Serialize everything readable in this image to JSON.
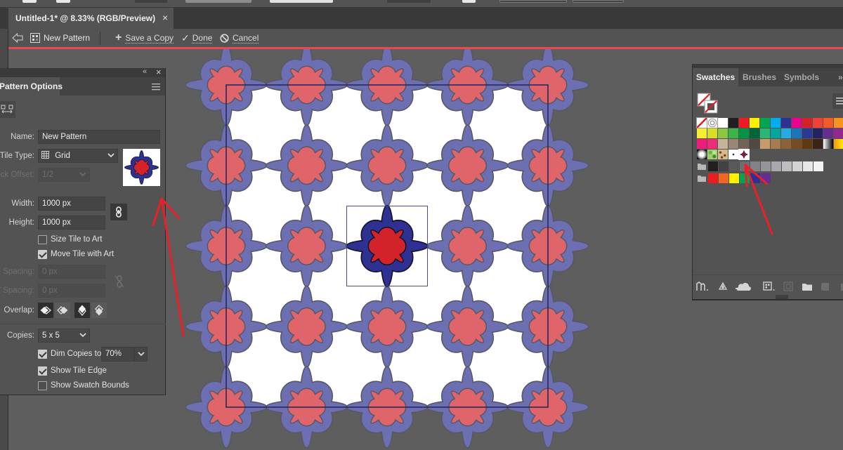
{
  "document_tab": {
    "title": "Untitled-1* @ 8.33% (RGB/Preview)",
    "close_label": "×"
  },
  "pattern_bar": {
    "pattern_name": "New Pattern",
    "save_copy_label": "Save a Copy",
    "done_label": "Done",
    "cancel_label": "Cancel",
    "accent_color": "#e8484f",
    "icons": [
      "exit-isolation-arrow-icon",
      "pattern-icon",
      "plus-icon",
      "checkmark-icon",
      "cancel-circle-icon"
    ]
  },
  "pattern_options": {
    "title": "Pattern Options",
    "collapse_label": "«",
    "close_label": "×",
    "name": {
      "label": "Name:",
      "value": "New Pattern"
    },
    "tile_type": {
      "label": "Tile Type:",
      "value": "Grid"
    },
    "brick_offset": {
      "label": "Brick Offset:",
      "value": "1/2",
      "disabled": true
    },
    "width": {
      "label": "Width:",
      "value": "1000 px"
    },
    "height": {
      "label": "Height:",
      "value": "1000 px"
    },
    "size_tile_to_art": {
      "label": "Size Tile to Art",
      "checked": false
    },
    "move_tile_with_art": {
      "label": "Move Tile with Art",
      "checked": true
    },
    "h_spacing": {
      "label": "H Spacing:",
      "value": "0 px",
      "disabled": true
    },
    "v_spacing": {
      "label": "V Spacing:",
      "value": "0 px",
      "disabled": true
    },
    "overlap": {
      "label": "Overlap:",
      "options": [
        {
          "name": "left-in-front",
          "selected": true
        },
        {
          "name": "right-in-front",
          "selected": false
        },
        {
          "name": "top-in-front",
          "selected": true
        },
        {
          "name": "bottom-in-front",
          "selected": false
        }
      ]
    },
    "copies": {
      "label": "Copies:",
      "value": "5 x 5"
    },
    "dim_copies": {
      "label": "Dim Copies to:",
      "checked": true,
      "value": "70%"
    },
    "show_tile_edge": {
      "label": "Show Tile Edge",
      "checked": true
    },
    "show_swatch_bounds": {
      "label": "Show Swatch Bounds",
      "checked": false
    }
  },
  "artwork": {
    "outer_petal_color": "#2e3192",
    "inner_petal_color": "#d2232a",
    "outline_color": "#111122",
    "tile_fill": "#ffffff",
    "tile_edge_color": "#23235a",
    "selection_color": "#4a4a8a"
  },
  "swatches_panel": {
    "tabs": [
      "Swatches",
      "Brushes",
      "Symbols"
    ],
    "overflow_label": "»",
    "rows": [
      [
        "none",
        "registration",
        "#ffffff",
        "#231f20",
        "#ed1c24",
        "#fff200",
        "#00a651",
        "#00aeef",
        "#2e3192",
        "#ec008c",
        "#d2232a",
        "#ef4136",
        "#f15a29",
        "#f7941d"
      ],
      [
        "#f9ed32",
        "#d7df23",
        "#8dc63f",
        "#39b54a",
        "#009444",
        "#006838",
        "#2bb673",
        "#00a79d",
        "#27aae1",
        "#1c75bc",
        "#2b3990",
        "#262262",
        "#662d91",
        "#92278f"
      ],
      [
        "#ed1e79",
        "#ee2a7b",
        "#c2b59b",
        "#998675",
        "#736357",
        "#534741",
        "#c69c6d",
        "#a67c52",
        "#8c6239",
        "#754c24",
        "#603913",
        "#3c2415",
        "gradient-white-black",
        "gradient-orange-yellow"
      ],
      [
        "gradient-radial",
        "pattern-foliage",
        "pattern-leopard",
        "pattern-dot",
        "pattern-new"
      ]
    ],
    "groups": [
      [
        "#231f20",
        "#414042",
        "#58595b",
        "#6d6e71",
        "#808285",
        "#939598",
        "#a7a9ac",
        "#bcbec0",
        "#d1d3d4",
        "#e6e7e8",
        "#f1f2f2"
      ],
      [
        "#ed1c24",
        "#f26522",
        "#fff200",
        "#00a651",
        "#2e3192",
        "#662d91"
      ]
    ],
    "bottom_icons": [
      "swatch-libraries-icon",
      "show-kinds-icon",
      "cloud-library-icon",
      "swatch-options-icon",
      "new-color-group-icon",
      "new-folder-icon",
      "new-swatch-icon",
      "delete-swatch-icon"
    ]
  },
  "annotations": {
    "arrow_color": "#e8202a"
  }
}
